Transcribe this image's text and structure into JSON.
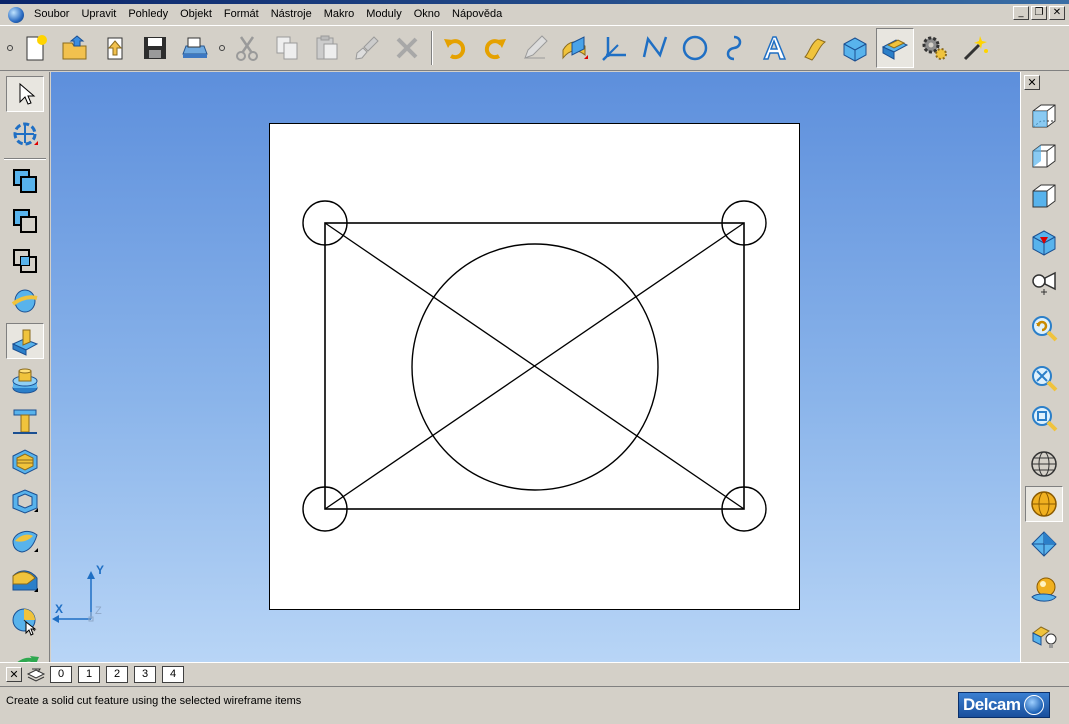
{
  "menu": {
    "items": [
      "Soubor",
      "Upravit",
      "Pohledy",
      "Objekt",
      "Formát",
      "Nástroje",
      "Makro",
      "Moduly",
      "Okno",
      "Nápověda"
    ]
  },
  "window_buttons": {
    "minimize": "_",
    "restore": "❐",
    "close": "✕"
  },
  "toolbar": {
    "buttons": [
      "new-model-icon",
      "open-model-icon",
      "import-icon",
      "save-icon",
      "print-icon",
      "cut-icon",
      "copy-icon",
      "paste-icon",
      "delete-brush-icon",
      "delete-icon",
      "undo-icon",
      "redo-icon",
      "edit-pencil-icon",
      "surface-blend-icon",
      "workplane-icon",
      "polyline-icon",
      "circle-icon",
      "curve-icon",
      "text-icon",
      "surface-icon",
      "solid-icon",
      "feature-icon",
      "gear-settings-icon",
      "magic-wand-icon"
    ]
  },
  "left_toolbar": {
    "buttons": [
      "select-arrow-icon",
      "rotate-view-icon",
      "boolean-add-icon",
      "boolean-subtract-icon",
      "boolean-intersect-icon",
      "solid-split-icon",
      "solid-cut-icon",
      "boss-icon",
      "pocket-icon",
      "shell-icon",
      "hollow-icon",
      "fillet-icon",
      "chamfer-icon",
      "draft-icon",
      "analyze-icon"
    ]
  },
  "right_toolbar": {
    "close": "✕",
    "buttons": [
      "view-iso-1-icon",
      "view-iso-2-icon",
      "view-front-icon",
      "view-top-icon",
      "camera-view-icon",
      "zoom-previous-icon",
      "zoom-fit-icon",
      "zoom-box-icon",
      "wireframe-shading-icon",
      "solid-shading-icon",
      "plane-icon",
      "shaded-sphere-icon",
      "lighting-icon"
    ]
  },
  "triad": {
    "x": "X",
    "y": "Y",
    "z": "Z"
  },
  "levels": {
    "close": "✕",
    "buttons": [
      "0",
      "1",
      "2",
      "3",
      "4"
    ]
  },
  "status": {
    "text": "Create a solid cut feature using the selected wireframe items"
  },
  "brand": {
    "name": "Delcam"
  },
  "colors": {
    "accent": "#1a5fb4",
    "viewport_top": "#5d8fdc",
    "viewport_bottom": "#b8d5f6"
  }
}
